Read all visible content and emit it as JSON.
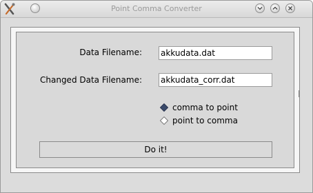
{
  "window": {
    "title": "Point Comma Converter",
    "icon": "app-tools-icon",
    "controls": [
      "minimize-icon",
      "maximize-icon",
      "close-icon"
    ]
  },
  "form": {
    "data_filename_label": "Data Filename:",
    "data_filename_value": "akkudata.dat",
    "changed_filename_label": "Changed Data Filename:",
    "changed_filename_value": "akkudata_corr.dat"
  },
  "mode": {
    "options": [
      {
        "label": "comma to point",
        "selected": true
      },
      {
        "label": "point to comma",
        "selected": false
      }
    ]
  },
  "action": {
    "button_label": "Do it!"
  },
  "colors": {
    "background": "#dcdcdc",
    "selected_radio": "#3a4a6a"
  }
}
